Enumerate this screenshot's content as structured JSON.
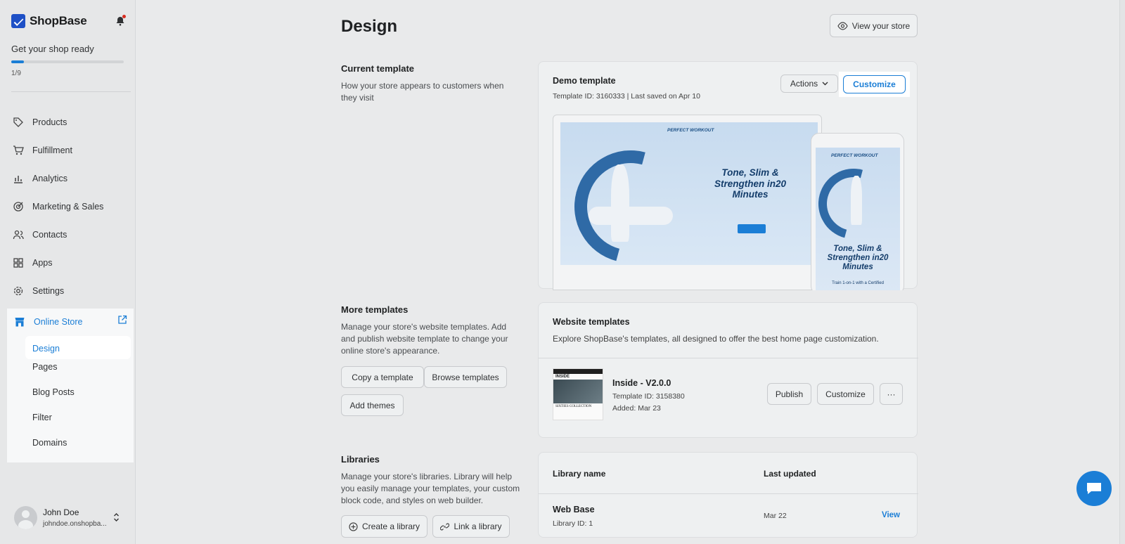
{
  "brand": {
    "name": "ShopBase"
  },
  "setup": {
    "title": "Get your shop ready",
    "count": "1/9",
    "progress_fraction": 0.111
  },
  "nav": {
    "items": [
      {
        "id": "products",
        "label": "Products",
        "icon": "tag-icon"
      },
      {
        "id": "fulfillment",
        "label": "Fulfillment",
        "icon": "cart-icon"
      },
      {
        "id": "analytics",
        "label": "Analytics",
        "icon": "bar-chart-icon"
      },
      {
        "id": "marketing",
        "label": "Marketing & Sales",
        "icon": "target-icon"
      },
      {
        "id": "contacts",
        "label": "Contacts",
        "icon": "users-icon"
      },
      {
        "id": "apps",
        "label": "Apps",
        "icon": "grid-icon"
      },
      {
        "id": "settings",
        "label": "Settings",
        "icon": "gear-icon"
      }
    ],
    "online_store": {
      "label": "Online Store",
      "sub": [
        "Design",
        "Pages",
        "Blog Posts",
        "Filter",
        "Domains"
      ]
    }
  },
  "user": {
    "name": "John Doe",
    "domain": "johndoe.onshopba..."
  },
  "page": {
    "title": "Design",
    "view_store": "View your store"
  },
  "current_template": {
    "title": "Current template",
    "desc": "How your store appears to customers when they visit",
    "name": "Demo template",
    "meta": "Template ID: 3160333 | Last saved on Apr 10",
    "actions_label": "Actions",
    "customize_label": "Customize",
    "preview": {
      "brand": "PERFECT WORKOUT",
      "headline": "Tone, Slim & Strengthen in20 Minutes",
      "subline": "Train 1-on-1 with a Certified"
    }
  },
  "more_templates": {
    "title": "More templates",
    "desc": "Manage your store's website templates. Add and publish website template to change your online store's appearance.",
    "copy_label": "Copy a template",
    "browse_label": "Browse templates",
    "add_themes_label": "Add themes",
    "card_title": "Website templates",
    "card_desc": "Explore ShopBase's templates, all designed to offer the best home page customization.",
    "template": {
      "name": "Inside - V2.0.0",
      "id": "Template ID: 3158380",
      "added": "Added: Mar 23",
      "thumb_brand": "INSIDE",
      "thumb_caption": "SIXTIES COLLECTION",
      "publish_label": "Publish",
      "customize_label": "Customize",
      "more_label": "···"
    }
  },
  "libraries": {
    "title": "Libraries",
    "desc": "Manage your store's libraries. Library will help you easily manage your templates, your custom block code, and styles on web builder.",
    "create_label": "Create a library",
    "link_label": "Link a library",
    "col_name": "Library name",
    "col_updated": "Last updated",
    "rows": [
      {
        "name": "Web Base",
        "id": "Library ID: 1",
        "updated": "Mar 22",
        "action": "View"
      }
    ]
  },
  "colors": {
    "accent": "#1b7ed6",
    "brand": "#1e50c6",
    "notify": "#d92d20"
  }
}
